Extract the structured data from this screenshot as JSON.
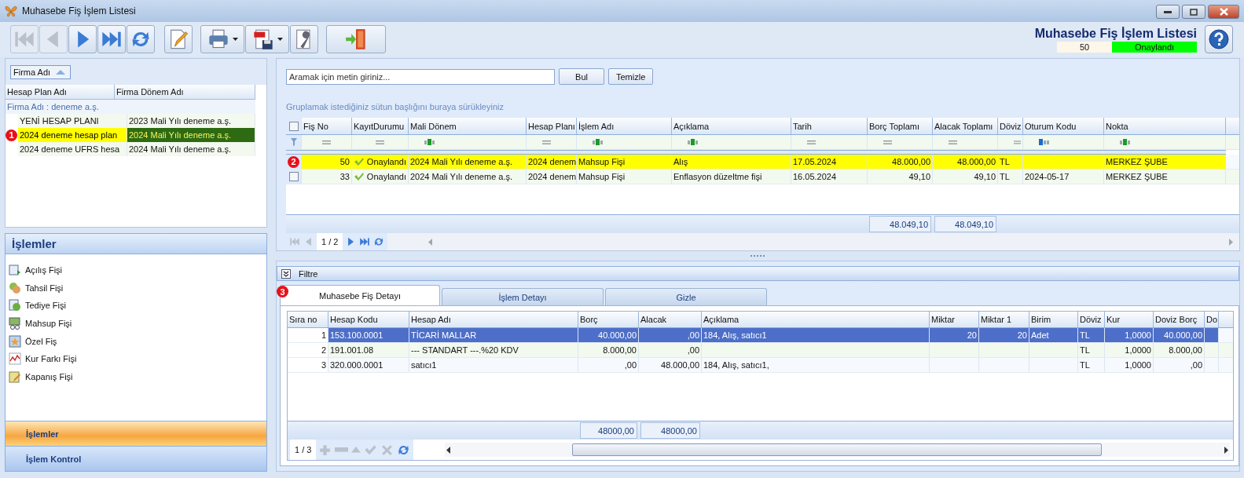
{
  "window": {
    "title": "Muhasebe Fiş İşlem Listesi"
  },
  "toolbar": [
    {
      "kind": "first",
      "disabled": true
    },
    {
      "kind": "prev",
      "disabled": true
    },
    {
      "kind": "next",
      "disabled": false
    },
    {
      "kind": "last",
      "disabled": false
    },
    {
      "kind": "refresh",
      "disabled": false
    },
    {
      "kind": "edit",
      "disabled": false
    },
    {
      "kind": "print",
      "disabled": false
    },
    {
      "kind": "pdf",
      "disabled": false
    },
    {
      "kind": "tools",
      "disabled": false
    },
    {
      "kind": "exit",
      "disabled": false
    }
  ],
  "header": {
    "title": "Muhasebe Fiş İşlem Listesi",
    "number": "50",
    "status": "Onaylandı"
  },
  "tree": {
    "sort_button": "Firma Adı",
    "columns": [
      "Hesap Plan Adı",
      "Firma Dönem Adı"
    ],
    "group": "Firma Adı : deneme a.ş.",
    "rows": [
      {
        "cells": [
          "YENİ HESAP PLANI",
          "2023 Mali Yılı deneme a.ş."
        ],
        "selected": false
      },
      {
        "cells": [
          "2024 deneme hesap plan",
          "2024 Mali Yılı deneme a.ş."
        ],
        "selected": true,
        "badge": "1"
      },
      {
        "cells": [
          "2024 deneme UFRS hesa",
          "2024 Mali Yılı deneme a.ş."
        ],
        "selected": false
      }
    ]
  },
  "actions": {
    "title": "İşlemler",
    "items": [
      {
        "label": "Açılış Fişi",
        "kind": "opening"
      },
      {
        "label": "Tahsil Fişi",
        "kind": "collect"
      },
      {
        "label": "Tediye Fişi",
        "kind": "pay"
      },
      {
        "label": "Mahsup Fişi",
        "kind": "offset"
      },
      {
        "label": "Özel Fiş",
        "kind": "special"
      },
      {
        "label": "Kur Farkı Fişi",
        "kind": "rate"
      },
      {
        "label": "Kapanış Fişi",
        "kind": "closing"
      }
    ],
    "sections": [
      {
        "label": "İşlemler",
        "selected": true
      },
      {
        "label": "İşlem Kontrol",
        "selected": false
      }
    ]
  },
  "search": {
    "placeholder": "Aramak için metin giriniz...",
    "buttons": [
      "Bul",
      "Temizle"
    ]
  },
  "group_hint": "Gruplamak istediğiniz sütun başlığını buraya sürükleyiniz",
  "main_grid": {
    "header_checked": false,
    "columns": [
      "Fiş No",
      "KayıtDurumu",
      "Mali Dönem",
      "Hesap Planı",
      "İşlem Adı",
      "Açıklama",
      "Tarih",
      "Borç Toplamı",
      "Alacak Toplamı",
      "Döviz",
      "Oturum Kodu",
      "Nokta"
    ],
    "filters": [
      {
        "kind": "equals"
      },
      {
        "kind": "equals"
      },
      {
        "kind": "text"
      },
      {
        "kind": "equals"
      },
      {
        "kind": "text"
      },
      {
        "kind": "text"
      },
      {
        "kind": "equals"
      },
      {
        "kind": "equals"
      },
      {
        "kind": "equals"
      },
      {
        "kind": "equals"
      },
      {
        "kind": "text-start"
      },
      {
        "kind": "text"
      }
    ],
    "rows": [
      {
        "selected": true,
        "badge": "2",
        "fis_no": "50",
        "kayit_durumu": "Onaylandı",
        "mali_donem": "2024 Mali Yılı deneme a.ş.",
        "hesap_plani": "2024 denem",
        "islem_adi": "Mahsup Fişi",
        "aciklama": "Alış",
        "tarih": "17.05.2024",
        "borc_toplami": "48.000,00",
        "alacak_toplami": "48.000,00",
        "doviz": "TL",
        "nokta": "MERKEZ ŞUBE"
      },
      {
        "checked": false,
        "selected": false,
        "fis_no": "33",
        "kayit_durumu": "Onaylandı",
        "mali_donem": "2024 Mali Yılı deneme a.ş.",
        "hesap_plani": "2024 denem",
        "islem_adi": "Mahsup Fişi",
        "aciklama": "Enflasyon düzeltme fişi",
        "tarih": "16.05.2024",
        "borc_toplami": "49,10",
        "alacak_toplami": "49,10",
        "doviz": "TL",
        "oturum_kodu": "2024-05-17",
        "nokta": "MERKEZ ŞUBE"
      }
    ],
    "totals": {
      "borc_toplami": "48.049,10",
      "alacak_toplami": "48.049,10"
    },
    "pager": "1 / 2",
    "pager_buttons": [
      {
        "kind": "first",
        "disabled": true
      },
      {
        "kind": "prev",
        "disabled": true
      },
      {
        "kind": "next",
        "disabled": false
      },
      {
        "kind": "last",
        "disabled": false
      },
      {
        "kind": "refresh",
        "disabled": false
      }
    ]
  },
  "filter_bar": {
    "label": "Filtre"
  },
  "tabs": [
    {
      "label": "Muhasebe Fiş Detayı",
      "selected": true,
      "badge": "3"
    },
    {
      "label": "İşlem Detayı",
      "selected": false
    },
    {
      "label": "Gizle",
      "selected": false
    }
  ],
  "detail_grid": {
    "columns": [
      "Sıra no",
      "Hesap Kodu",
      "Hesap Adı",
      "Borç",
      "Alacak",
      "Açıklama",
      "Miktar",
      "Miktar 1",
      "Birim",
      "Döviz",
      "Kur",
      "Doviz Borç",
      "Do"
    ],
    "rows": [
      {
        "selected": true,
        "sira_no": "1",
        "hesap_kodu": "153.100.0001",
        "hesap_adi": "TİCARİ MALLAR",
        "borc": "40.000,00",
        "alacak": ",00",
        "aciklama": "184, Alış, satıcı1",
        "miktar": "20",
        "miktar_1": "20",
        "birim": "Adet",
        "doviz": "TL",
        "kur": "1,0000",
        "doviz_borc": "40.000,00"
      },
      {
        "selected": false,
        "sira_no": "2",
        "hesap_kodu": "191.001.08",
        "hesap_adi": "--- STANDART ---.%20 KDV",
        "borc": "8.000,00",
        "alacak": ",00",
        "doviz": "TL",
        "kur": "1,0000",
        "doviz_borc": "8.000,00"
      },
      {
        "selected": false,
        "sira_no": "3",
        "hesap_kodu": "320.000.0001",
        "hesap_adi": "satıcı1",
        "borc": ",00",
        "alacak": "48.000,00",
        "aciklama": "184, Alış, satıcı1,",
        "doviz": "TL",
        "kur": "1,0000",
        "doviz_borc": ",00"
      }
    ],
    "totals": {
      "borc": "48000,00",
      "alacak": "48000,00"
    },
    "pager": "1 / 3",
    "pager_buttons": [
      {
        "kind": "add",
        "disabled": true
      },
      {
        "kind": "remove",
        "disabled": true
      },
      {
        "kind": "up",
        "disabled": true
      },
      {
        "kind": "check",
        "disabled": true
      },
      {
        "kind": "cancel",
        "disabled": true
      },
      {
        "kind": "refresh",
        "disabled": false
      }
    ]
  }
}
